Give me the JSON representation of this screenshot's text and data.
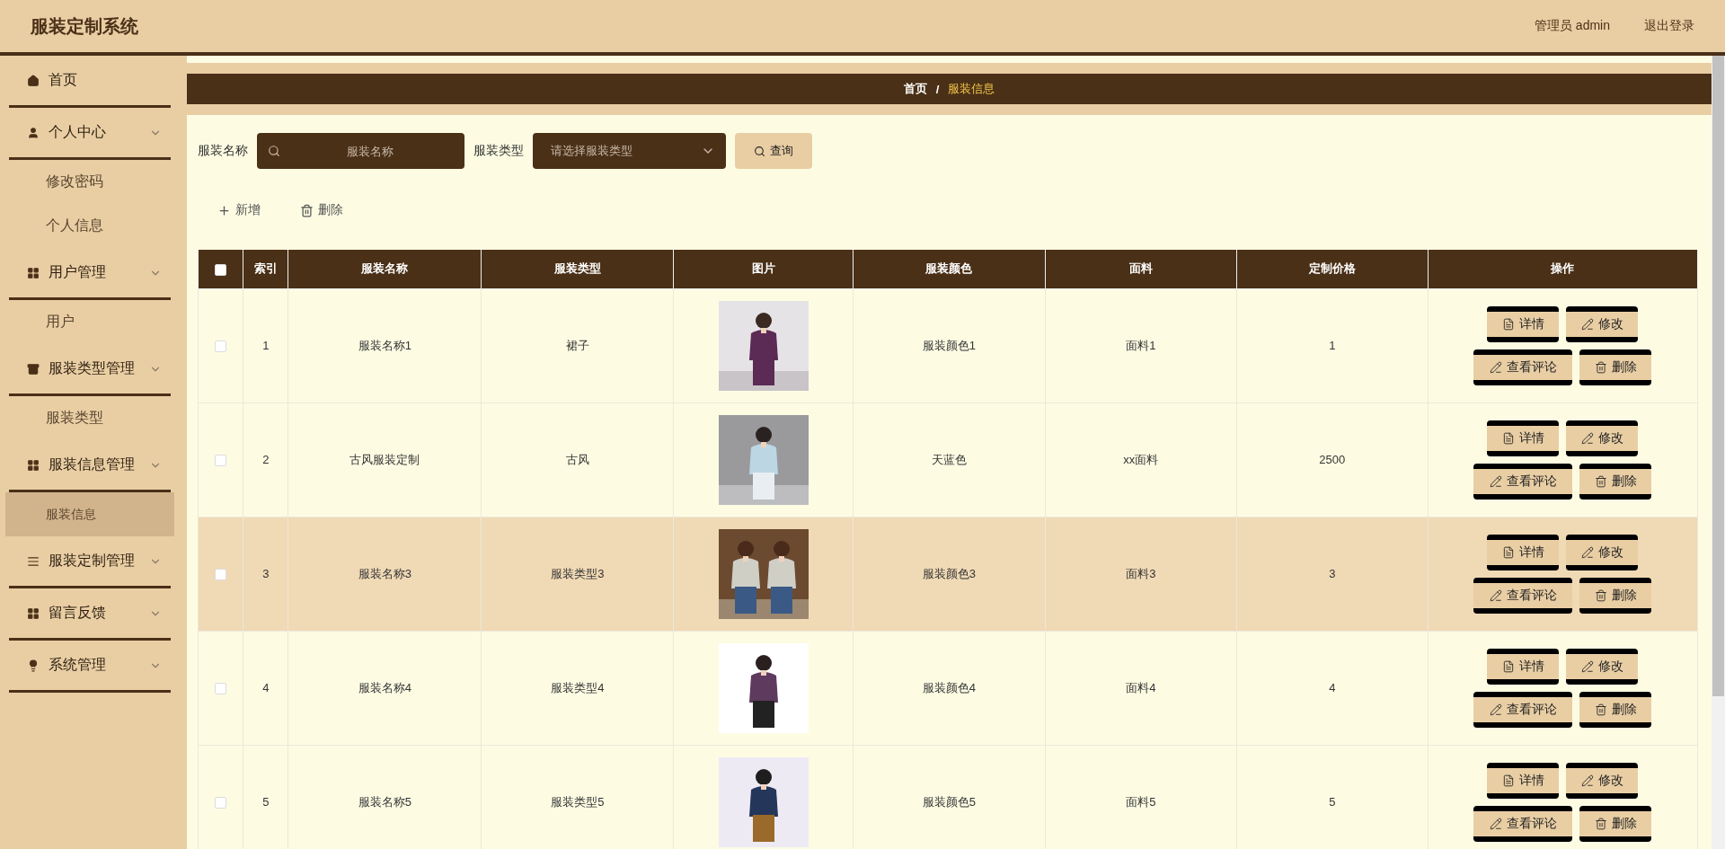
{
  "header": {
    "title": "服装定制系统",
    "user": "管理员 admin",
    "logout": "退出登录"
  },
  "sidebar": {
    "items": [
      {
        "label": "首页",
        "kind": "link",
        "selected": false
      },
      {
        "label": "个人中心",
        "kind": "group",
        "selected": false,
        "children": [
          {
            "label": "修改密码",
            "selected": false
          },
          {
            "label": "个人信息",
            "selected": false
          }
        ]
      },
      {
        "label": "用户管理",
        "kind": "group",
        "selected": false,
        "children": [
          {
            "label": "用户",
            "selected": false
          }
        ]
      },
      {
        "label": "服装类型管理",
        "kind": "group",
        "selected": false,
        "children": [
          {
            "label": "服装类型",
            "selected": false
          }
        ]
      },
      {
        "label": "服装信息管理",
        "kind": "group",
        "selected": false,
        "children": [
          {
            "label": "服装信息",
            "selected": true
          }
        ]
      },
      {
        "label": "服装定制管理",
        "kind": "group",
        "selected": false
      },
      {
        "label": "留言反馈",
        "kind": "group",
        "selected": false
      },
      {
        "label": "系统管理",
        "kind": "group",
        "selected": false
      }
    ]
  },
  "breadcrumb": {
    "separator": "/",
    "items": [
      {
        "label": "首页",
        "current": false
      },
      {
        "label": "服装信息",
        "current": true
      }
    ]
  },
  "search": {
    "name_label": "服装名称",
    "name_placeholder": "服装名称",
    "type_label": "服装类型",
    "type_placeholder": "请选择服装类型",
    "button": "查询"
  },
  "toolbar": [
    {
      "label": "新增",
      "kind": "add"
    },
    {
      "label": "删除",
      "kind": "delete"
    }
  ],
  "table": {
    "select_all": {
      "checked": false
    },
    "columns": [
      "索引",
      "服装名称",
      "服装类型",
      "图片",
      "服装颜色",
      "面料",
      "定制价格",
      "操作"
    ],
    "rows": [
      {
        "checked": false,
        "highlighted": false,
        "index": "1",
        "name": "服装名称1",
        "type": "裙子",
        "image": {
          "kind": "picture"
        },
        "garment_color": "服装颜色1",
        "fabric": "面料1",
        "price": "1",
        "actions": [
          {
            "label": "详情",
            "kind": "detail"
          },
          {
            "label": "修改",
            "kind": "edit"
          },
          {
            "label": "查看评论",
            "kind": "comment"
          },
          {
            "label": "删除",
            "kind": "delete"
          }
        ]
      },
      {
        "checked": false,
        "highlighted": false,
        "index": "2",
        "name": "古风服装定制",
        "type": "古风",
        "image": {
          "kind": "picture"
        },
        "garment_color": "天蓝色",
        "fabric": "xx面料",
        "price": "2500",
        "actions": [
          {
            "label": "详情",
            "kind": "detail"
          },
          {
            "label": "修改",
            "kind": "edit"
          },
          {
            "label": "查看评论",
            "kind": "comment"
          },
          {
            "label": "删除",
            "kind": "delete"
          }
        ]
      },
      {
        "checked": false,
        "highlighted": true,
        "index": "3",
        "name": "服装名称3",
        "type": "服装类型3",
        "image": {
          "kind": "picture"
        },
        "garment_color": "服装颜色3",
        "fabric": "面料3",
        "price": "3",
        "actions": [
          {
            "label": "详情",
            "kind": "detail"
          },
          {
            "label": "修改",
            "kind": "edit"
          },
          {
            "label": "查看评论",
            "kind": "comment"
          },
          {
            "label": "删除",
            "kind": "delete"
          }
        ]
      },
      {
        "checked": false,
        "highlighted": false,
        "index": "4",
        "name": "服装名称4",
        "type": "服装类型4",
        "image": {
          "kind": "picture"
        },
        "garment_color": "服装颜色4",
        "fabric": "面料4",
        "price": "4",
        "actions": [
          {
            "label": "详情",
            "kind": "detail"
          },
          {
            "label": "修改",
            "kind": "edit"
          },
          {
            "label": "查看评论",
            "kind": "comment"
          },
          {
            "label": "删除",
            "kind": "delete"
          }
        ]
      },
      {
        "checked": false,
        "highlighted": false,
        "index": "5",
        "name": "服装名称5",
        "type": "服装类型5",
        "image": {
          "kind": "picture"
        },
        "garment_color": "服装颜色5",
        "fabric": "面料5",
        "price": "5",
        "actions": [
          {
            "label": "详情",
            "kind": "detail"
          },
          {
            "label": "修改",
            "kind": "edit"
          },
          {
            "label": "查看评论",
            "kind": "comment"
          },
          {
            "label": "删除",
            "kind": "delete"
          }
        ]
      }
    ]
  }
}
